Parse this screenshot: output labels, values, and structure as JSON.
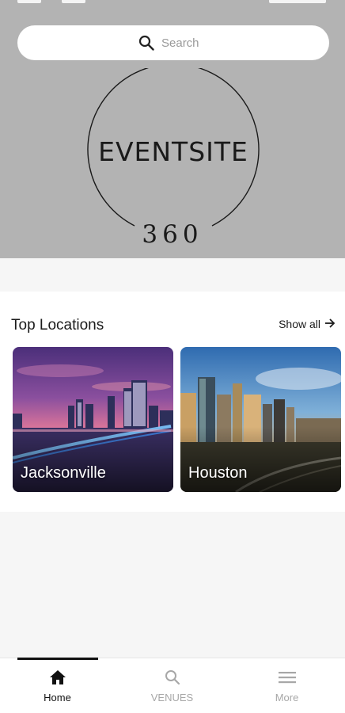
{
  "search": {
    "placeholder": "Search"
  },
  "logo": {
    "title": "EVENTSITE",
    "number": "360"
  },
  "top_locations": {
    "title": "Top Locations",
    "show_all_label": "Show all",
    "cards": [
      {
        "name": "Jacksonville"
      },
      {
        "name": "Houston"
      }
    ]
  },
  "bottom_nav": {
    "items": [
      {
        "label": "Home",
        "icon": "home-icon",
        "active": true
      },
      {
        "label": "VENUES",
        "icon": "search-icon",
        "active": false
      },
      {
        "label": "More",
        "icon": "menu-icon",
        "active": false
      }
    ]
  },
  "colors": {
    "hero_bg": "#b3b3b3",
    "page_bg": "#f6f6f6",
    "text_dark": "#1c1c1c",
    "nav_inactive": "#a7a7a7"
  }
}
